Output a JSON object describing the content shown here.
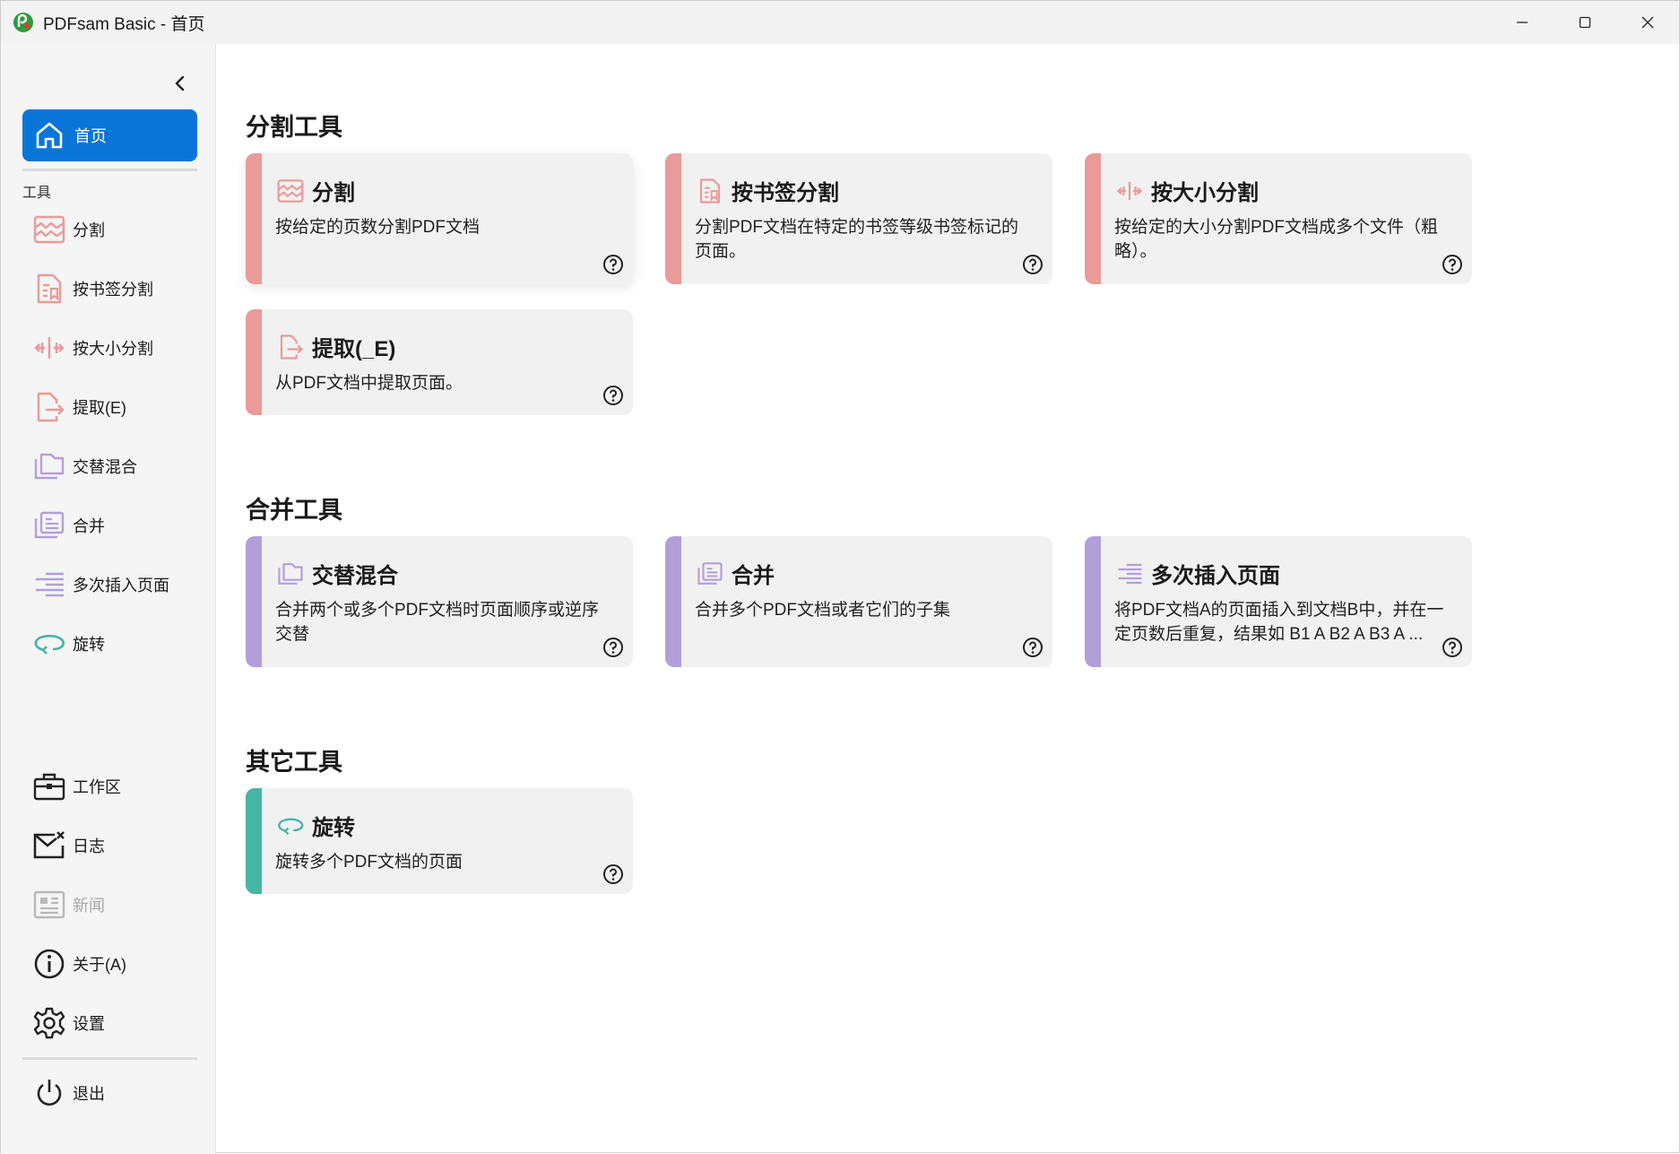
{
  "window": {
    "title": "PDFsam Basic - 首页"
  },
  "colors": {
    "accent_blue": "#0a75d9",
    "split_red": "#e99a99",
    "merge_purple": "#b29fd9",
    "other_teal": "#45b5a6"
  },
  "sidebar": {
    "home_label": "首页",
    "tools_label": "工具",
    "tools": [
      {
        "label": "分割",
        "icon": "split-icon"
      },
      {
        "label": "按书签分割",
        "icon": "bookmark-split-icon"
      },
      {
        "label": "按大小分割",
        "icon": "size-split-icon"
      },
      {
        "label": "提取(E)",
        "icon": "extract-icon"
      },
      {
        "label": "交替混合",
        "icon": "alternate-mix-icon"
      },
      {
        "label": "合并",
        "icon": "merge-icon"
      },
      {
        "label": "多次插入页面",
        "icon": "insert-pages-icon"
      },
      {
        "label": "旋转",
        "icon": "rotate-icon"
      }
    ],
    "bottom": [
      {
        "label": "工作区",
        "icon": "briefcase-icon"
      },
      {
        "label": "日志",
        "icon": "log-mail-icon"
      },
      {
        "label": "新闻",
        "icon": "news-icon"
      },
      {
        "label": "关于(A)",
        "icon": "info-icon"
      },
      {
        "label": "设置",
        "icon": "gear-icon"
      }
    ],
    "exit_label": "退出"
  },
  "groups": {
    "split": {
      "title": "分割工具",
      "cards": [
        {
          "name": "分割",
          "desc": "按给定的页数分割PDF文档"
        },
        {
          "name": "按书签分割",
          "desc": "分割PDF文档在特定的书签等级书签标记的页面。"
        },
        {
          "name": "按大小分割",
          "desc": "按给定的大小分割PDF文档成多个文件（粗略）。"
        },
        {
          "name": "提取(_E)",
          "desc": "从PDF文档中提取页面。"
        }
      ]
    },
    "merge": {
      "title": "合并工具",
      "cards": [
        {
          "name": "交替混合",
          "desc": "合并两个或多个PDF文档时页面顺序或逆序交替"
        },
        {
          "name": "合并",
          "desc": "合并多个PDF文档或者它们的子集"
        },
        {
          "name": "多次插入页面",
          "desc": "将PDF文档A的页面插入到文档B中，并在一定页数后重复，结果如 B1 A B2 A B3 A ..."
        }
      ]
    },
    "other": {
      "title": "其它工具",
      "cards": [
        {
          "name": "旋转",
          "desc": "旋转多个PDF文档的页面"
        }
      ]
    }
  }
}
